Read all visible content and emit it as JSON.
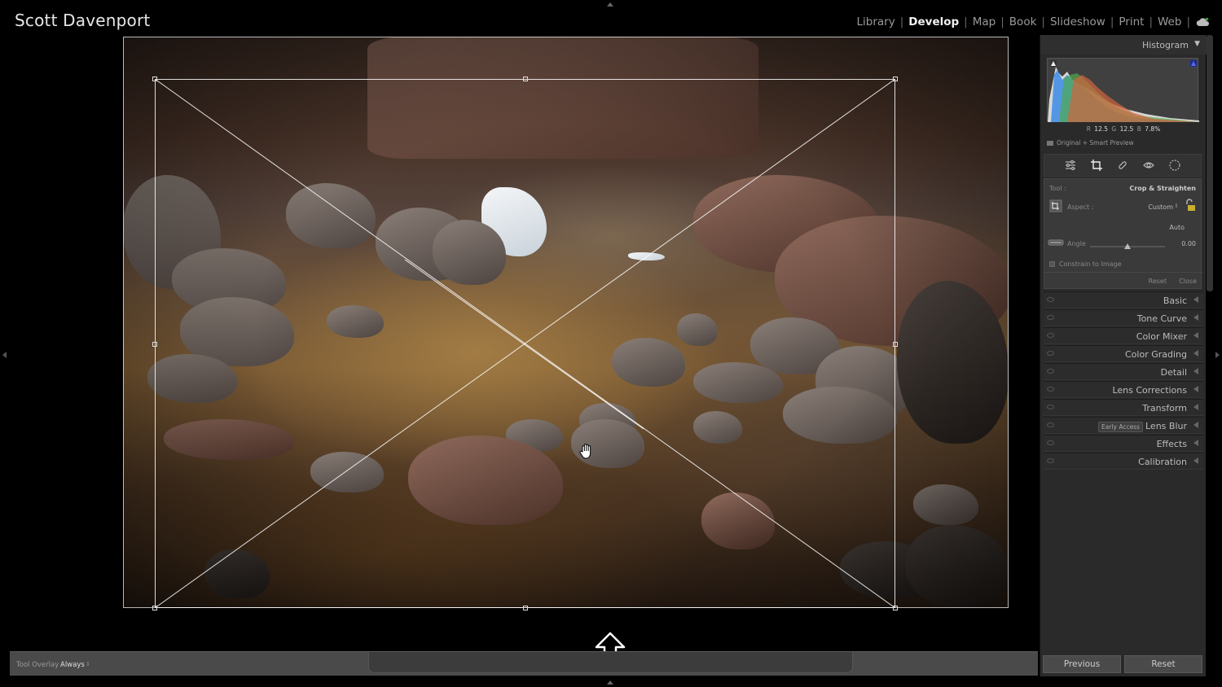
{
  "identity_plate": "Scott Davenport",
  "modules": [
    {
      "label": "Library",
      "active": false
    },
    {
      "label": "Develop",
      "active": true
    },
    {
      "label": "Map",
      "active": false
    },
    {
      "label": "Book",
      "active": false
    },
    {
      "label": "Slideshow",
      "active": false
    },
    {
      "label": "Print",
      "active": false
    },
    {
      "label": "Web",
      "active": false
    }
  ],
  "module_separator": "|",
  "histogram": {
    "title": "Histogram",
    "readout": {
      "r_label": "R",
      "r_value": "12.5",
      "g_label": "G",
      "g_value": "12.5",
      "b_label": "B",
      "b_value": "7.8",
      "unit": "%"
    },
    "preview_status": "Original + Smart Preview"
  },
  "tool_strip": [
    "sliders-icon",
    "crop-icon",
    "heal-icon",
    "redeye-icon",
    "mask-icon"
  ],
  "crop_panel": {
    "tool_label": "Tool :",
    "tool_value": "Crop & Straighten",
    "aspect_label": "Aspect :",
    "aspect_value": "Custom",
    "auto_label": "Auto",
    "angle_label": "Angle",
    "angle_value": "0.00",
    "angle_level": 0.5,
    "constrain_label": "Constrain to Image",
    "reset_label": "Reset",
    "close_label": "Close"
  },
  "sections": [
    {
      "label": "Basic"
    },
    {
      "label": "Tone Curve"
    },
    {
      "label": "Color Mixer"
    },
    {
      "label": "Color Grading"
    },
    {
      "label": "Detail"
    },
    {
      "label": "Lens Corrections"
    },
    {
      "label": "Transform"
    },
    {
      "label": "Lens Blur",
      "badge": "Early Access"
    },
    {
      "label": "Effects"
    },
    {
      "label": "Calibration"
    }
  ],
  "toolbar": {
    "overlay_label": "Tool Overlay :",
    "overlay_value": "Always"
  },
  "buttons": {
    "previous": "Previous",
    "reset": "Reset"
  },
  "colors": {
    "panel_bg": "#2a2a2a",
    "active_module": "#f0f0f0",
    "crop_lock": "#c8b030"
  }
}
